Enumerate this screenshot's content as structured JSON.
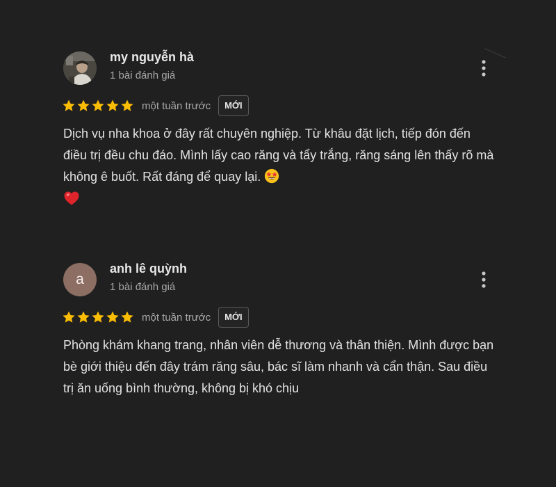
{
  "reviews": [
    {
      "author": "my nguyễn hà",
      "review_count": "1 bài đánh giá",
      "avatar_letter": "",
      "rating": 5,
      "time": "một tuần trước",
      "badge": "MỚI",
      "text": "Dịch vụ nha khoa ở đây rất chuyên nghiệp. Từ khâu đặt lịch, tiếp đón đến điều trị đều chu đáo. Mình lấy cao răng và tẩy trắng, răng sáng lên thấy rõ mà không ê buốt. Rất đáng để quay lại.",
      "emojis": [
        "star-struck-emoji",
        "red-heart-emoji"
      ]
    },
    {
      "author": "anh lê quỳnh",
      "review_count": "1 bài đánh giá",
      "avatar_letter": "a",
      "rating": 5,
      "time": "một tuần trước",
      "badge": "MỚI",
      "text": "Phòng khám khang trang, nhân viên dễ thương và thân thiện. Mình được bạn bè giới thiệu đến đây trám răng sâu, bác sĩ làm nhanh và cẩn thận. Sau điều trị ăn uống bình thường, không bị khó chịu",
      "emojis": []
    }
  ],
  "colors": {
    "background": "#202020",
    "star": "#fbbc04",
    "text_primary": "#e2e2e2",
    "text_secondary": "#a8a8a8",
    "avatar_letter_bg": "#8d6e63"
  },
  "icons": {
    "more": "more-vert-icon",
    "star": "star-icon"
  }
}
